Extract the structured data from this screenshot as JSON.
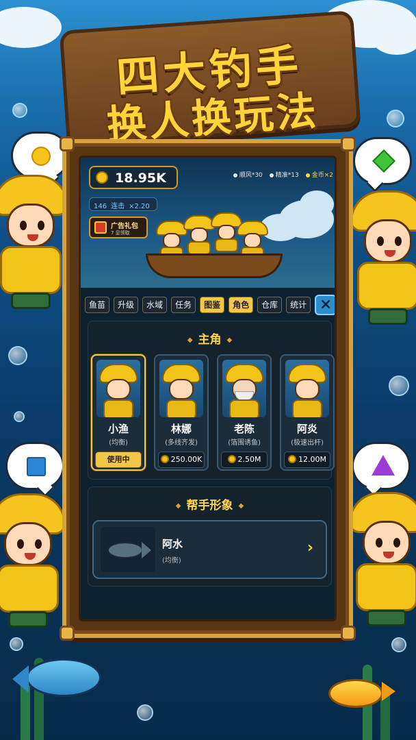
{
  "title": {
    "line1": "四大钓手",
    "line2": "换人换玩法"
  },
  "hud": {
    "coins": "18.95K",
    "stats": [
      {
        "label": "顺风*30",
        "highlight": false
      },
      {
        "label": "精准*13",
        "highlight": false
      },
      {
        "label": "金币×2",
        "highlight": true
      }
    ],
    "combo_count": "146",
    "combo_label": "连击",
    "combo_multiplier": "×2.20",
    "ad_gift_label": "广告礼包",
    "ad_gift_sub": "7 显领取"
  },
  "tabs": [
    {
      "label": "鱼苗",
      "active": false
    },
    {
      "label": "升级",
      "active": false
    },
    {
      "label": "水域",
      "active": false
    },
    {
      "label": "任务",
      "active": false
    },
    {
      "label": "图鉴",
      "active": true
    },
    {
      "label": "角色",
      "active": true
    },
    {
      "label": "仓库",
      "active": false
    },
    {
      "label": "统计",
      "active": false
    }
  ],
  "close_label": "×",
  "protagonist": {
    "heading": "主角",
    "cards": [
      {
        "name": "小渔",
        "role": "(均衡)",
        "action": "使用中",
        "state": "in_use"
      },
      {
        "name": "林娜",
        "role": "(多线齐发)",
        "action": "250.00K",
        "state": "price"
      },
      {
        "name": "老陈",
        "role": "(箔围诱鱼)",
        "action": "2.50M",
        "state": "price"
      },
      {
        "name": "阿炎",
        "role": "(极速出杆)",
        "action": "12.00M",
        "state": "price"
      }
    ]
  },
  "helper": {
    "heading": "帮手形象",
    "name": "阿水",
    "role": "(均衡)"
  },
  "colors": {
    "accent_gold": "#f1c84a",
    "panel": "#14222d",
    "board_wood": "#5a3514"
  },
  "icons": [
    "coin-icon",
    "gift-icon",
    "close-icon",
    "chevron-right-icon",
    "circle-shape-icon",
    "diamond-shape-icon",
    "square-shape-icon",
    "triangle-shape-icon"
  ]
}
